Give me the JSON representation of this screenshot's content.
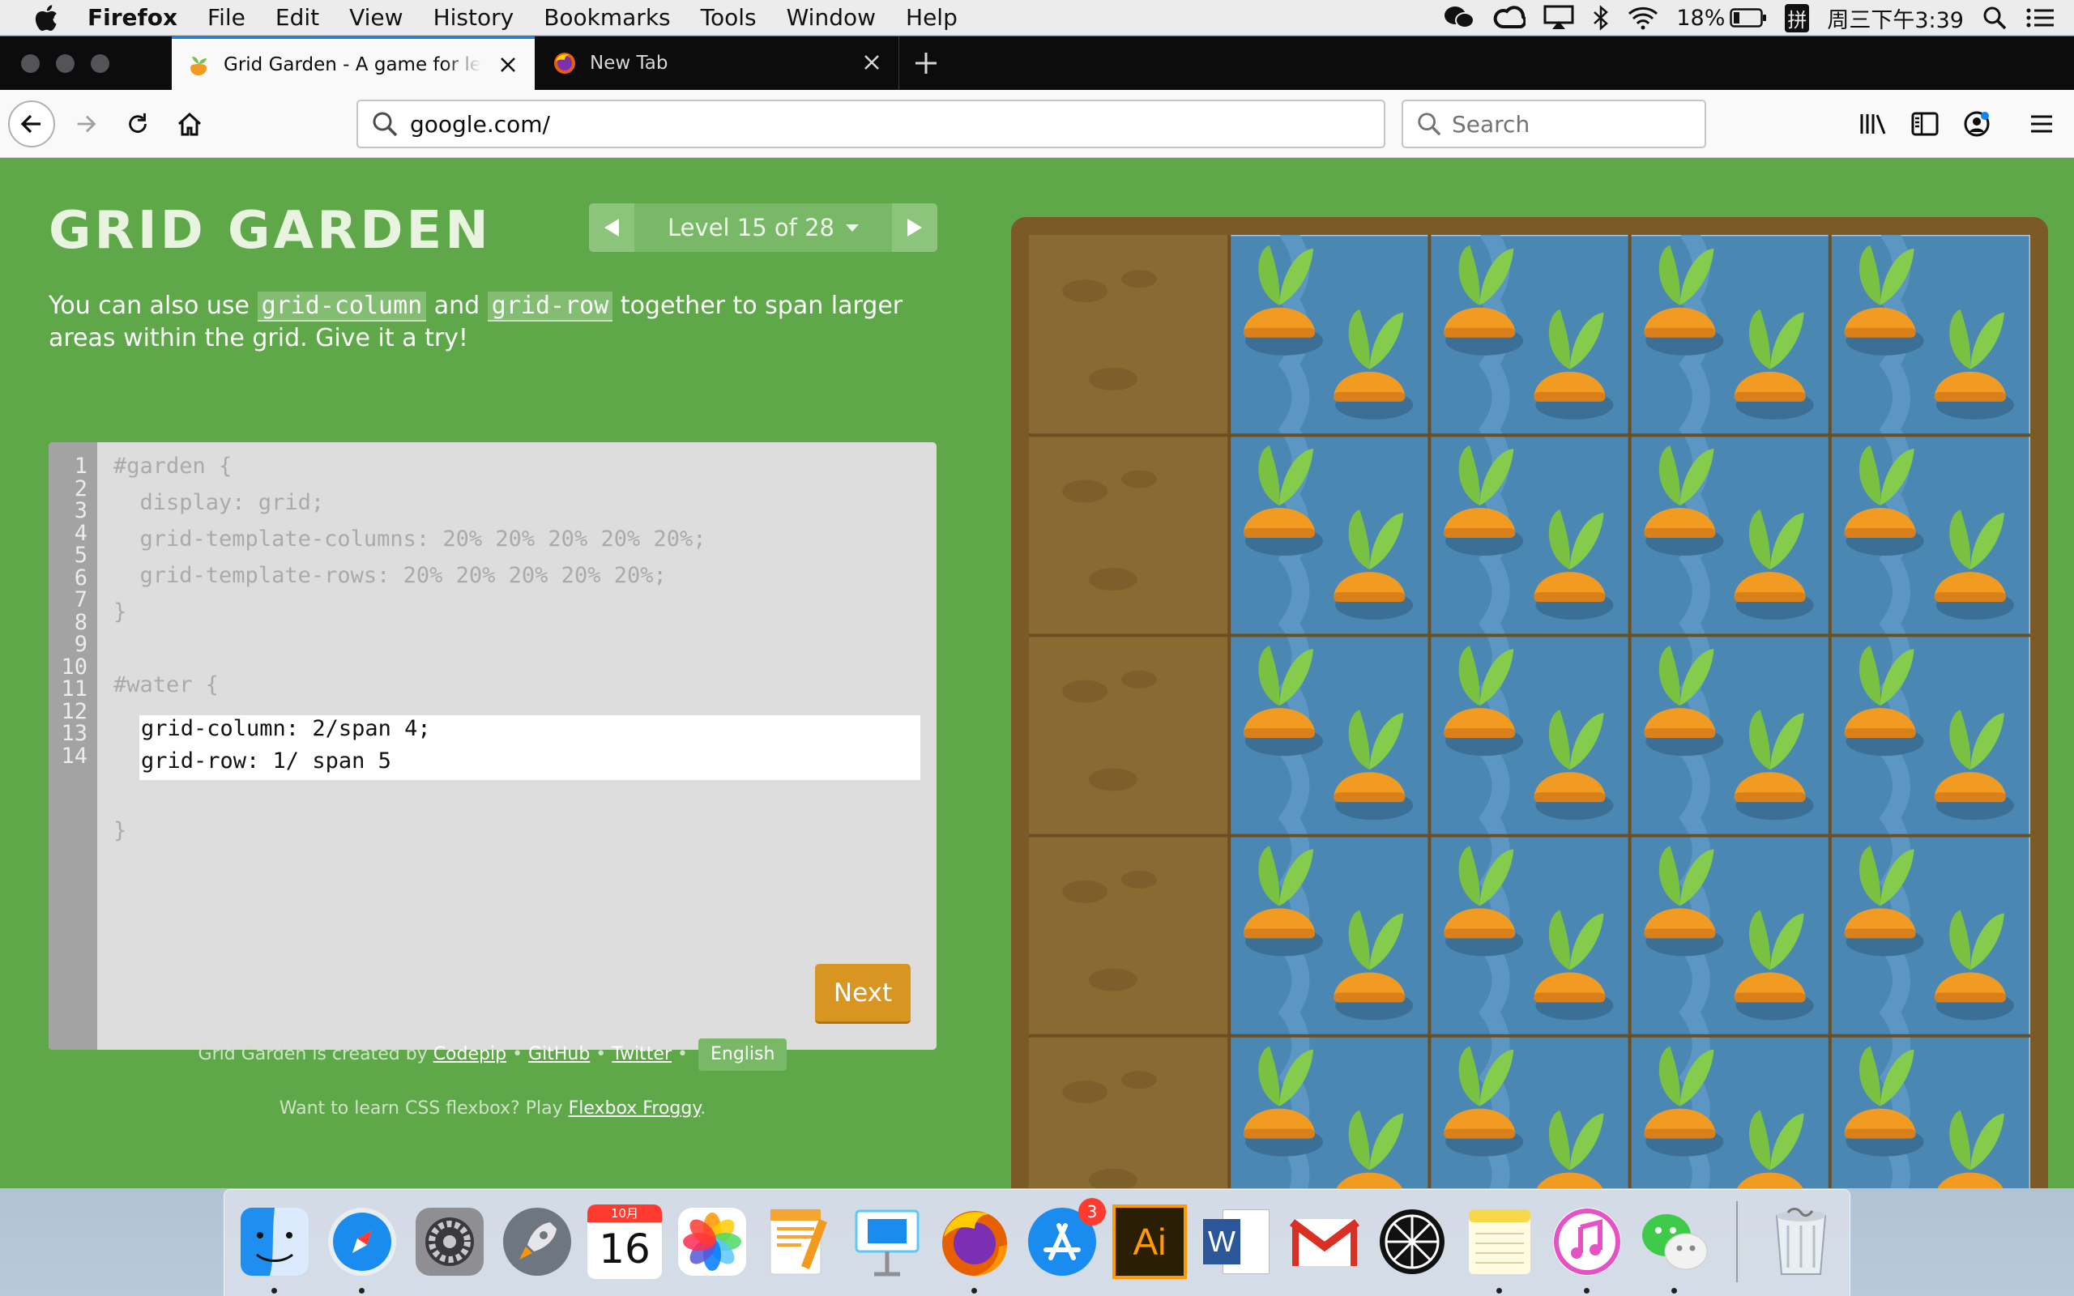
{
  "menubar": {
    "items": [
      "Firefox",
      "File",
      "Edit",
      "View",
      "History",
      "Bookmarks",
      "Tools",
      "Window",
      "Help"
    ],
    "battery": "18%",
    "input_method": "拼",
    "clock": "周三下午3:39"
  },
  "browser": {
    "tabs": [
      {
        "title": "Grid Garden - A game for learning CSS grid",
        "active": true
      },
      {
        "title": "New Tab",
        "active": false
      }
    ],
    "url": "google.com/",
    "search_placeholder": "Search"
  },
  "game": {
    "logo": "GRID GARDEN",
    "level_label": "Level 15 of 28",
    "instructions": {
      "pre": "You can also use ",
      "code1": "grid-column",
      "mid": " and ",
      "code2": "grid-row",
      "post": " together to span larger areas within the grid. Give it a try!"
    },
    "line_numbers": [
      "1",
      "2",
      "3",
      "4",
      "5",
      "6",
      "7",
      "8",
      "9",
      "10",
      "11",
      "12",
      "13",
      "14"
    ],
    "code_before": [
      "#garden {",
      "  display: grid;",
      "  grid-template-columns: 20% 20% 20% 20% 20%;",
      "  grid-template-rows: 20% 20% 20% 20% 20%;",
      "}",
      "",
      "#water {"
    ],
    "code_input": [
      "grid-column: 2/span 4;",
      "grid-row: 1/ span 5"
    ],
    "code_after": [
      "}"
    ],
    "next_label": "Next",
    "credits": {
      "prefix": "Grid Garden is created by",
      "codepip": "Codepip",
      "github": "GitHub",
      "twitter": "Twitter",
      "language": "English",
      "sep": "•"
    },
    "promo": {
      "text": "Want to learn CSS flexbox? Play",
      "link": "Flexbox Froggy",
      "end": "."
    },
    "garden": {
      "columns": 5,
      "rows": 5,
      "water": {
        "column_start": 2,
        "column_span": 4,
        "row_start": 1,
        "row_span": 5
      }
    }
  },
  "dock": {
    "apps": [
      "Finder",
      "Safari",
      "System Preferences",
      "Launchpad",
      "Calendar",
      "Photos",
      "Pages",
      "Keynote",
      "Firefox",
      "App Store",
      "Illustrator",
      "Word",
      "Mail",
      "Lemon",
      "Notes",
      "iTunes",
      "WeChat",
      "Trash"
    ],
    "calendar_month": "10月",
    "calendar_day": "16",
    "appstore_badge": "3",
    "illustrator_label": "Ai",
    "word_label": "W"
  },
  "colors": {
    "page_bg": "#5fa84a",
    "water": "#4a87b3",
    "soil": "#8a6a33",
    "carrot": "#f29b22",
    "leaf": "#7ac142",
    "next": "#d99521"
  }
}
